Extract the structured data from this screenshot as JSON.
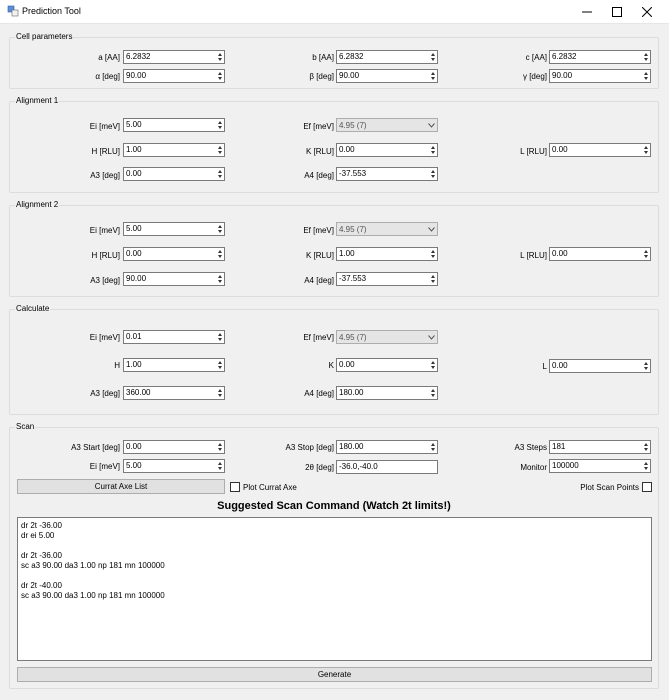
{
  "window": {
    "title": "Prediction Tool",
    "controls": {
      "minimize": "—",
      "maximize": "☐",
      "close": "✕"
    }
  },
  "cell": {
    "title": "Cell parameters",
    "a_label": "a [AA]",
    "a": "6.2832",
    "b_label": "b [AA]",
    "b": "6.2832",
    "c_label": "c [AA]",
    "c": "6.2832",
    "alpha_label": "α [deg]",
    "alpha": "90.00",
    "beta_label": "β [deg]",
    "beta": "90.00",
    "gamma_label": "γ [deg]",
    "gamma": "90.00"
  },
  "align1": {
    "title": "Alignment 1",
    "ei_label": "Ei [meV]",
    "ei": "5.00",
    "ef_label": "Ef [meV]",
    "ef": "4.95 (7)",
    "h_label": "H [RLU]",
    "h": "1.00",
    "k_label": "K [RLU]",
    "k": "0.00",
    "l_label": "L [RLU]",
    "l": "0.00",
    "a3_label": "A3 [deg]",
    "a3": "0.00",
    "a4_label": "A4 [deg]",
    "a4": "-37.553"
  },
  "align2": {
    "title": "Alignment 2",
    "ei_label": "Ei [meV]",
    "ei": "5.00",
    "ef_label": "Ef [meV]",
    "ef": "4.95 (7)",
    "h_label": "H [RLU]",
    "h": "0.00",
    "k_label": "K [RLU]",
    "k": "1.00",
    "l_label": "L [RLU]",
    "l": "0.00",
    "a3_label": "A3 [deg]",
    "a3": "90.00",
    "a4_label": "A4 [deg]",
    "a4": "-37.553"
  },
  "calc": {
    "title": "Calculate",
    "ei_label": "Ei [meV]",
    "ei": "0.01",
    "ef_label": "Ef [meV]",
    "ef": "4.95 (7)",
    "h_label": "H",
    "h": "1.00",
    "k_label": "K",
    "k": "0.00",
    "l_label": "L",
    "l": "0.00",
    "a3_label": "A3 [deg]",
    "a3": "360.00",
    "a4_label": "A4 [deg]",
    "a4": "180.00"
  },
  "scan": {
    "title": "Scan",
    "a3start_label": "A3 Start [deg]",
    "a3start": "0.00",
    "a3stop_label": "A3 Stop [deg]",
    "a3stop": "180.00",
    "a3steps_label": "A3 Steps",
    "a3steps": "181",
    "ei_label": "Ei [meV]",
    "ei": "5.00",
    "twotheta_label": "2θ [deg]",
    "twotheta": "-36.0,-40.0",
    "monitor_label": "Monitor",
    "monitor": "100000",
    "currat_button": "Currat Axe List",
    "plot_currat_label": "Plot Currat Axe",
    "plot_scan_label": "Plot Scan Points"
  },
  "suggested": {
    "heading": "Suggested Scan Command (Watch 2t limits!)",
    "lines": [
      "dr 2t -36.00",
      "dr ei 5.00",
      "",
      "dr 2t -36.00",
      "sc a3 90.00 da3 1.00 np 181 mn 100000",
      "",
      "dr 2t -40.00",
      "sc a3 90.00 da3 1.00 np 181 mn 100000"
    ]
  },
  "generate_label": "Generate"
}
